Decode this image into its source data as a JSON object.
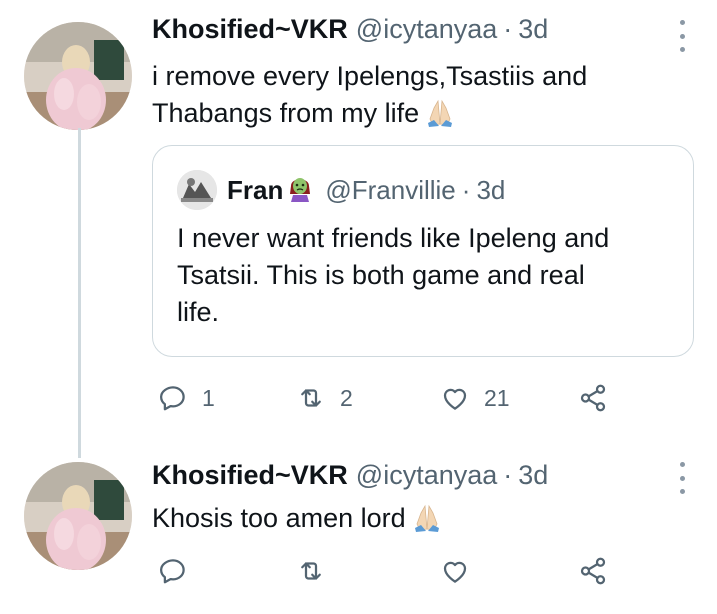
{
  "tweets": [
    {
      "display_name": "Khosified~VKR",
      "handle": "@icytanyaa",
      "separator": "·",
      "time": "3d",
      "text_line1": "i remove every Ipelengs,Tsastiis and",
      "text_line2": "Thabangs from my life",
      "emoji": "folded-hands-emoji",
      "quote": {
        "display_name": "Fran",
        "name_emoji": "zombie-woman-emoji",
        "handle": "@Franvillie",
        "separator": "·",
        "time": "3d",
        "text_line1": "I never want friends like Ipeleng and",
        "text_line2": "Tsatsii. This is both game and real",
        "text_line3": "life."
      },
      "actions": {
        "reply_count": "1",
        "retweet_count": "2",
        "like_count": "21"
      }
    },
    {
      "display_name": "Khosified~VKR",
      "handle": "@icytanyaa",
      "separator": "·",
      "time": "3d",
      "text_line1": "Khosis too amen lord",
      "emoji": "folded-hands-emoji"
    }
  ],
  "icons": {
    "reply": "reply-icon",
    "retweet": "retweet-icon",
    "like": "like-icon",
    "share": "share-icon",
    "more": "more-options-icon"
  },
  "colors": {
    "text": "#0f1419",
    "secondary": "#536471",
    "border": "#cfd9de"
  }
}
